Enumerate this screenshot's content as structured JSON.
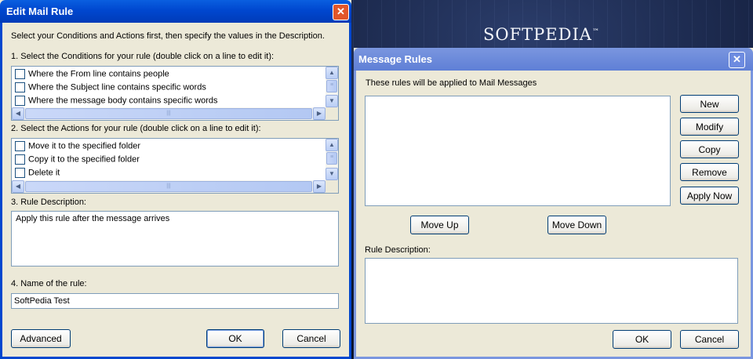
{
  "background": {
    "logo_text": "SOFTPEDIA",
    "logo_mark": "™"
  },
  "edit_rule": {
    "title": "Edit Mail Rule",
    "intro": "Select your Conditions and Actions first, then specify the values in the Description.",
    "conditions_label": "1. Select the Conditions for your rule (double click on a line to edit it):",
    "conditions": [
      {
        "label": "Where the From line contains people",
        "checked": false
      },
      {
        "label": "Where the Subject line contains specific words",
        "checked": false
      },
      {
        "label": "Where the message body contains specific words",
        "checked": false
      }
    ],
    "actions_label": "2. Select the Actions for your rule (double click on a line to edit it):",
    "actions": [
      {
        "label": "Move it to the specified folder",
        "checked": false
      },
      {
        "label": "Copy it to the specified folder",
        "checked": false
      },
      {
        "label": "Delete it",
        "checked": false
      }
    ],
    "description_label": "3. Rule Description:",
    "description_text": "Apply this rule after the message arrives",
    "name_label": "4. Name of the rule:",
    "name_value": "SoftPedia Test",
    "advanced_label": "Advanced",
    "ok_label": "OK",
    "cancel_label": "Cancel"
  },
  "message_rules": {
    "title": "Message Rules",
    "rules_label": "These rules will be applied to Mail Messages",
    "buttons": {
      "new": "New",
      "modify": "Modify",
      "copy": "Copy",
      "remove": "Remove",
      "apply_now": "Apply Now",
      "move_up": "Move Up",
      "move_down": "Move Down",
      "ok": "OK",
      "cancel": "Cancel"
    },
    "description_label": "Rule Description:"
  },
  "colors": {
    "title_active": "#0047cf",
    "title_inactive": "#7a96df",
    "dialog_face": "#ece9d8",
    "close_button": "#e2562a"
  }
}
